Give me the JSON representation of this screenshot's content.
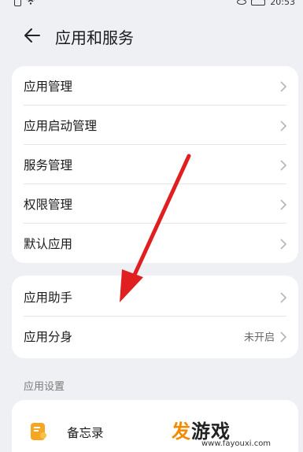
{
  "status_bar": {
    "time": "20:53"
  },
  "header": {
    "title": "应用和服务"
  },
  "group1": {
    "items": [
      {
        "label": "应用管理"
      },
      {
        "label": "应用启动管理"
      },
      {
        "label": "服务管理"
      },
      {
        "label": "权限管理"
      },
      {
        "label": "默认应用"
      }
    ]
  },
  "group2": {
    "items": [
      {
        "label": "应用助手",
        "value": ""
      },
      {
        "label": "应用分身",
        "value": "未开启"
      }
    ]
  },
  "section": {
    "title": "应用设置"
  },
  "app_settings": {
    "first_app": "备忘录"
  },
  "watermark": {
    "main_left": "发",
    "main_right": "游戏",
    "sub": "www.fayouxi.com"
  },
  "colors": {
    "annotation_arrow": "#e02020",
    "memo_icon": "#f5a623"
  }
}
